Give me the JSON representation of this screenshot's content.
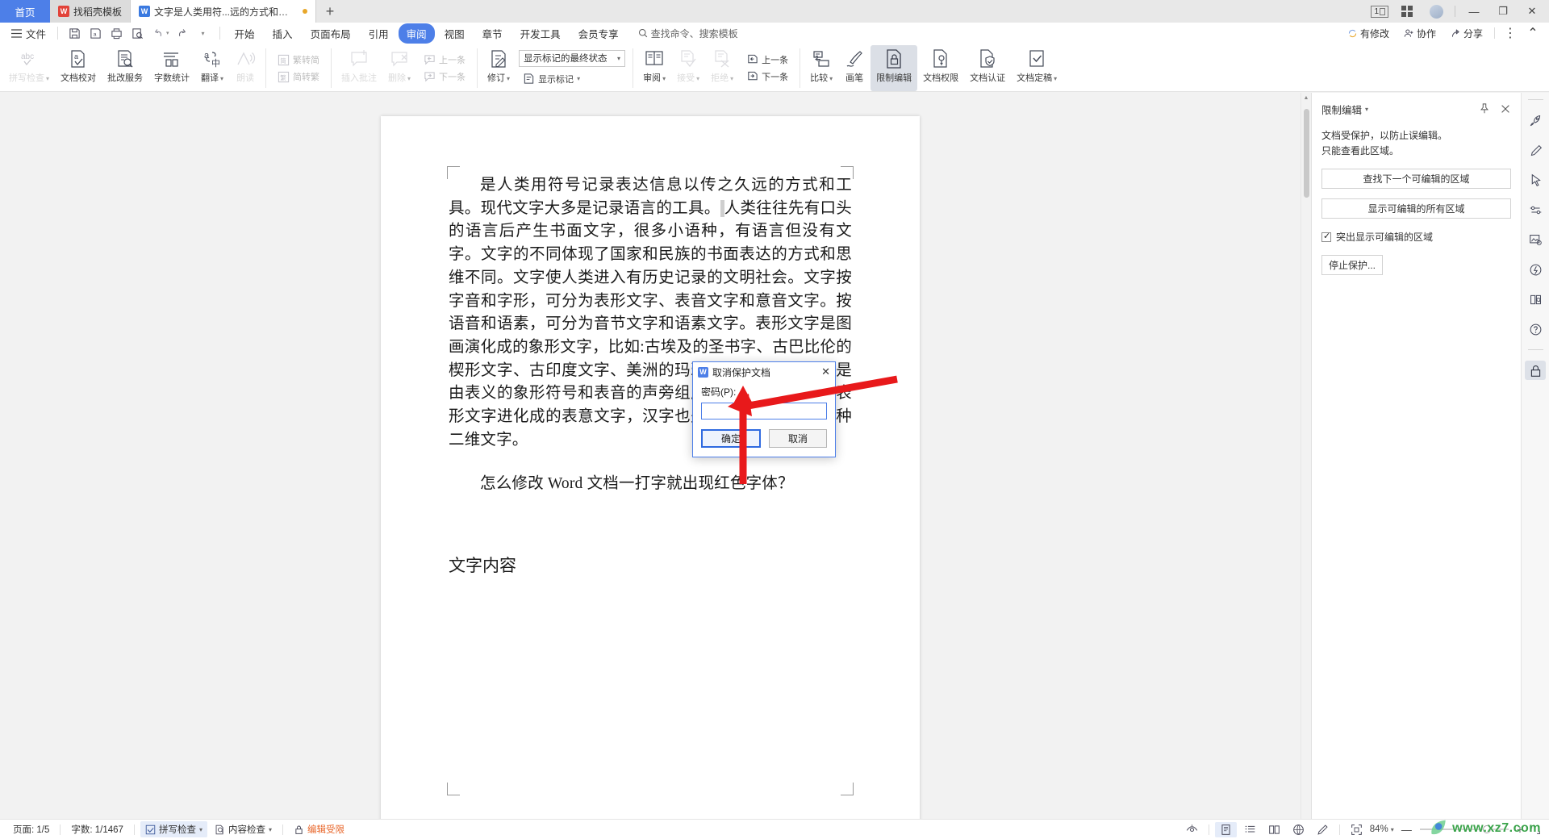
{
  "window": {
    "home_tab": "首页",
    "tabs": [
      {
        "label": "找稻壳模板",
        "icon": "wps-docer-icon",
        "active": false,
        "modified": false,
        "color": "#e2433a"
      },
      {
        "label": "文字是人类用符...远的方式和工具",
        "icon": "wps-writer-icon",
        "active": true,
        "modified": true,
        "color": "#3b7ae0"
      }
    ],
    "add_tab": "+",
    "page_indicator": "1",
    "controls": {
      "minimize": "—",
      "restore": "❐",
      "close": "✕"
    }
  },
  "menubar": {
    "file_label": "文件",
    "quick_icons": [
      "save-icon",
      "save-as-icon",
      "print-icon",
      "print-preview-icon",
      "undo-icon",
      "redo-icon",
      "customize-icon"
    ],
    "items": [
      {
        "label": "开始",
        "active": false
      },
      {
        "label": "插入",
        "active": false
      },
      {
        "label": "页面布局",
        "active": false
      },
      {
        "label": "引用",
        "active": false
      },
      {
        "label": "审阅",
        "active": true
      },
      {
        "label": "视图",
        "active": false
      },
      {
        "label": "章节",
        "active": false
      },
      {
        "label": "开发工具",
        "active": false
      },
      {
        "label": "会员专享",
        "active": false
      }
    ],
    "search_placeholder": "查找命令、搜索模板",
    "right": [
      {
        "label": "有修改",
        "icon": "sync-icon"
      },
      {
        "label": "协作",
        "icon": "collaborate-icon"
      },
      {
        "label": "分享",
        "icon": "share-icon"
      }
    ],
    "more": "⋮",
    "collapse": "⌃"
  },
  "ribbon": {
    "groups": [
      {
        "buttons": [
          {
            "label": "拼写检查",
            "icon": "spellcheck-icon",
            "caret": true,
            "disabled": true,
            "selected": false
          },
          {
            "label": "文档校对",
            "icon": "proofread-icon",
            "caret": false,
            "disabled": false,
            "selected": false
          },
          {
            "label": "批改服务",
            "icon": "correction-service-icon",
            "caret": false,
            "disabled": false,
            "selected": false
          },
          {
            "label": "字数统计",
            "icon": "word-count-icon",
            "caret": false,
            "disabled": false,
            "selected": false
          },
          {
            "label": "翻译",
            "icon": "translate-icon",
            "caret": true,
            "disabled": false,
            "selected": false
          },
          {
            "label": "朗读",
            "icon": "read-aloud-icon",
            "caret": false,
            "disabled": true,
            "selected": false
          }
        ]
      },
      {
        "stack": [
          {
            "label": "繁转简",
            "icon": "trad-to-simp-icon",
            "disabled": true
          },
          {
            "label": "简转繁",
            "icon": "simp-to-trad-icon",
            "disabled": true
          }
        ]
      },
      {
        "buttons": [
          {
            "label": "插入批注",
            "icon": "insert-comment-icon",
            "caret": false,
            "disabled": true,
            "selected": false
          },
          {
            "label": "删除",
            "icon": "delete-comment-icon",
            "caret": true,
            "disabled": true,
            "selected": false
          }
        ],
        "stack": [
          {
            "label": "上一条",
            "icon": "prev-comment-icon",
            "disabled": true
          },
          {
            "label": "下一条",
            "icon": "next-comment-icon",
            "disabled": true
          }
        ]
      },
      {
        "buttons": [
          {
            "label": "修订",
            "icon": "track-changes-icon",
            "caret": true,
            "disabled": false,
            "selected": false
          }
        ],
        "controls": {
          "markup_state": "显示标记的最终状态",
          "show_markup": "显示标记",
          "show_markup_icon": "show-markup-icon"
        }
      },
      {
        "buttons": [
          {
            "label": "审阅",
            "icon": "review-pane-icon",
            "caret": true,
            "disabled": false,
            "selected": false
          },
          {
            "label": "接受",
            "icon": "accept-icon",
            "caret": true,
            "disabled": true,
            "selected": false
          },
          {
            "label": "拒绝",
            "icon": "reject-icon",
            "caret": true,
            "disabled": true,
            "selected": false
          }
        ],
        "stack": [
          {
            "label": "上一条",
            "icon": "prev-change-icon",
            "disabled": false
          },
          {
            "label": "下一条",
            "icon": "next-change-icon",
            "disabled": false
          }
        ]
      },
      {
        "buttons": [
          {
            "label": "比较",
            "icon": "compare-icon",
            "caret": true,
            "disabled": false,
            "selected": false
          },
          {
            "label": "画笔",
            "icon": "brush-icon",
            "caret": false,
            "disabled": false,
            "selected": false
          },
          {
            "label": "限制编辑",
            "icon": "restrict-editing-icon",
            "caret": false,
            "disabled": false,
            "selected": true
          },
          {
            "label": "文档权限",
            "icon": "doc-permission-icon",
            "caret": false,
            "disabled": false,
            "selected": false
          },
          {
            "label": "文档认证",
            "icon": "doc-certify-icon",
            "caret": false,
            "disabled": false,
            "selected": false
          },
          {
            "label": "文档定稿",
            "icon": "doc-finalize-icon",
            "caret": true,
            "disabled": false,
            "selected": false
          }
        ]
      }
    ]
  },
  "document": {
    "paragraphs": [
      {
        "type": "body",
        "indent": true,
        "runs": [
          {
            "text": "是人类用符号记录表达信息以传之久远的方式和工具。现代文字大多是记录语言的工具。",
            "highlight": false
          },
          {
            "text": " ",
            "highlight": true
          },
          {
            "text": "人类往往先有口头的语言后产生书面文字，很多小语种，有语言但没有文字。文字的不同体现了国家和民族的书面表达的方式和思维不同。文字使人类进入有历史记录的文明社会。文字按字音和字形，可分为表形文字、表音文字和意音文字。按语音和语素，可分为音节文字和语素文字。表形文字是图画演化成的象形文字，比如:古埃及的圣书字、古巴比伦的楔形文字、古印度文字、美洲的玛雅文字等。意音文字是由表义的象形符号和表音的声旁组成的文字，汉字是由表形文字进化成的表意文字，汉字也是语素文字，也是一种二维文字。",
            "highlight": false
          }
        ]
      },
      {
        "type": "body",
        "indent": true,
        "runs": [
          {
            "text": "怎么修改 Word 文档一打字就出现红色字体？",
            "highlight": false
          }
        ]
      },
      {
        "type": "heading",
        "indent": false,
        "runs": [
          {
            "text": "文字内容",
            "highlight": false
          }
        ]
      }
    ]
  },
  "restrict_panel": {
    "title": "限制编辑",
    "caret": "▾",
    "pin_icon": "pin-icon",
    "close_icon": "close-icon",
    "description_line1": "文档受保护，以防止误编辑。",
    "description_line2": "只能查看此区域。",
    "find_next_button": "查找下一个可编辑的区域",
    "show_all_button": "显示可编辑的所有区域",
    "highlight_checkbox": {
      "label": "突出显示可编辑的区域",
      "checked": true
    },
    "stop_protection_button": "停止保护..."
  },
  "right_rail": {
    "icons": [
      {
        "name": "rocket-icon",
        "selected": false
      },
      {
        "name": "pen-icon",
        "selected": false
      },
      {
        "name": "cursor-icon",
        "selected": false
      },
      {
        "name": "sliders-icon",
        "selected": false
      },
      {
        "name": "image-tools-icon",
        "selected": false
      },
      {
        "name": "idea-icon",
        "selected": false
      },
      {
        "name": "book-search-icon",
        "selected": false
      },
      {
        "name": "help-icon",
        "selected": false
      },
      {
        "name": "lock-icon",
        "selected": true
      }
    ]
  },
  "dialog": {
    "title": "取消保护文档",
    "icon": "wps-writer-icon",
    "close": "✕",
    "password_label": "密码(P):",
    "password_value": "",
    "ok_button": "确定",
    "cancel_button": "取消"
  },
  "statusbar": {
    "left": [
      {
        "label": "页面: 1/5",
        "name": "page-count",
        "highlight": false,
        "caret": false,
        "icon": null
      },
      {
        "label": "字数: 1/1467",
        "name": "word-count",
        "highlight": false,
        "caret": false,
        "icon": null
      },
      {
        "label": "拼写检查",
        "name": "spellcheck-status",
        "highlight": true,
        "caret": true,
        "icon": "check-box-icon"
      },
      {
        "label": "内容检查",
        "name": "content-check-status",
        "highlight": false,
        "caret": true,
        "icon": "doc-search-icon"
      },
      {
        "label": "编辑受限",
        "name": "edit-restricted-status",
        "highlight": false,
        "caret": false,
        "icon": "lock-icon",
        "warn": true
      }
    ],
    "right": {
      "eye_icon": "eye-icon",
      "view_icons": [
        "print-layout-icon",
        "outline-icon",
        "reading-icon",
        "web-layout-icon",
        "writing-icon"
      ],
      "fullscreen_icon": "fullscreen-icon",
      "zoom_value": "84%",
      "zoom_caret": "▾",
      "minus": "—",
      "plus": "+"
    }
  },
  "watermark": {
    "text": "www.xz7.com",
    "color": "#3aa34a"
  },
  "colors": {
    "accent": "#4d7fe8",
    "selected_ribbon": "#dbdfe6",
    "warn": "#e8662a",
    "arrow_red": "#e8191b"
  }
}
